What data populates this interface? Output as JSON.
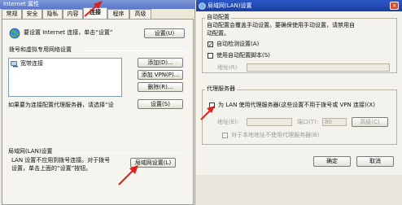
{
  "left_window": {
    "title": "Internet 属性",
    "tabs": [
      "常规",
      "安全",
      "隐私",
      "内容",
      "连接",
      "程序",
      "高级"
    ],
    "active_tab_index": 4,
    "setup_text": "要设置 Internet 连接，单击“设置”",
    "setup_button": "设置(U)",
    "dialup_section_title": "拨号和虚拟专用网络设置",
    "connections": [
      "宽带连接"
    ],
    "add_button": "添加(D)...",
    "add_vpn_button": "添加 VPN(P)...",
    "delete_button": "删除(R)...",
    "proxy_text": "如果要为连接配置代理服务器，请选择“设",
    "settings_button": "设置(S)",
    "lan_section_title": "局域网(LAN)设置",
    "lan_text_line1": "LAN 设置不应用到拨号连接。对于拨号",
    "lan_text_line2": "设置，单击上面的“设置”按钮。",
    "lan_button": "局域网设置(L)"
  },
  "right_window": {
    "title": "局域网(LAN)设置",
    "auto_group_title": "自动配置",
    "auto_desc_line1": "自动配置会覆盖手动设置。要确保使用手动设置，请禁用自",
    "auto_desc_line2": "动配置。",
    "auto_detect_label": "自动检测设置(A)",
    "auto_detect_checked": true,
    "auto_script_label": "使用自动配置脚本(S)",
    "auto_script_checked": false,
    "address_label": "地址(R)",
    "proxy_group_title": "代理服务器",
    "proxy_check_label": "为 LAN 使用代理服务器(这些设置不用于拨号或 VPN 连接)(X)",
    "proxy_checked": false,
    "proxy_address_label": "地址(E):",
    "proxy_port_label": "端口(T):",
    "proxy_port_value": "80",
    "advanced_button": "高级(C)",
    "bypass_label": "对于本地地址不使用代理服务器(B)",
    "ok_button": "确定",
    "cancel_button": "取消"
  },
  "colors": {
    "arrow": "#e0201a",
    "titlebar": "#2b57c6"
  }
}
